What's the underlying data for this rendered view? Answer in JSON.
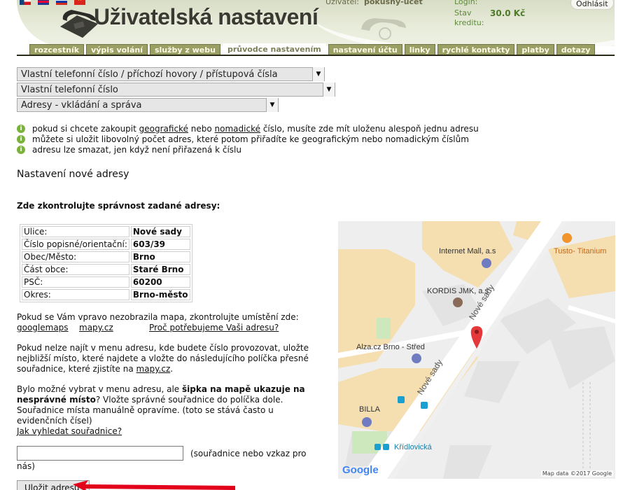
{
  "header": {
    "title": "Uživatelská nastavení",
    "user_label": "Uživatel:",
    "user_value": "pokusny-ucet",
    "login_label": "Login:",
    "credit_label": "Stav kreditu:",
    "credit_value": "30.0 Kč",
    "logout_label": "Odhlásit",
    "languages": [
      "cz-flag-icon",
      "gb-flag-icon",
      "ru-flag-icon",
      "vn-flag-icon"
    ]
  },
  "tabs": [
    {
      "label": "rozcestník",
      "active": false
    },
    {
      "label": "výpis volání",
      "active": false
    },
    {
      "label": "služby z webu",
      "active": false
    },
    {
      "label": "průvodce nastavením",
      "active": true
    },
    {
      "label": "nastavení účtu",
      "active": false
    },
    {
      "label": "linky",
      "active": false
    },
    {
      "label": "rychlé kontakty",
      "active": false
    },
    {
      "label": "platby",
      "active": false
    },
    {
      "label": "dotazy",
      "active": false
    }
  ],
  "selects": [
    {
      "value": "Vlastní telefonní číslo / příchozí hovory / přístupová čísla"
    },
    {
      "value": "Vlastní telefonní číslo"
    },
    {
      "value": "Adresy - vkládání a správa"
    }
  ],
  "info": {
    "line1_a": "pokud si chcete zakoupit ",
    "line1_link1": "geografické",
    "line1_b": " nebo ",
    "line1_link2": "nomadické",
    "line1_c": " číslo, musíte zde mít uloženu alespoň jednu adresu",
    "line2": "můžete si uložit libovolný počet adres, které potom přiřadíte ke geografickým nebo nomadickým číslům",
    "line3": "adresu lze smazat, jen když není přiřazená k číslu"
  },
  "section_title": "Nastavení nové adresy",
  "check_title": "Zde zkontrolujte správnost zadané adresy:",
  "address": [
    {
      "label": "Ulice:",
      "value": "Nové sady"
    },
    {
      "label": "Číslo popisné/orientační:",
      "value": "603/39"
    },
    {
      "label": "Obec/Město:",
      "value": "Brno"
    },
    {
      "label": "Část obce:",
      "value": "Staré Brno"
    },
    {
      "label": "PSČ:",
      "value": "60200"
    },
    {
      "label": "Okres:",
      "value": "Brno-město"
    }
  ],
  "para1": {
    "text": "Pokud se Vám vpravo nezobrazila mapa, zkontrolujte umístění zde:",
    "link_googlemaps": "googlemaps",
    "link_mapy": "mapy.cz",
    "link_why": "Proč potřebujeme Vaši adresu?"
  },
  "para2": {
    "text": "Pokud nelze najít v menu adresu, kde budete číslo provozovat, uložte nejbližší místo, které najdete a vložte do následujícího políčka přesné souřadnice, které zjistíte na ",
    "link": "mapy.cz",
    "end": "."
  },
  "para3": {
    "a": "Bylo možné vybrat v menu adresu, ale ",
    "bold": "šipka na mapě ukazuje na nesprávné místo",
    "b": "? Vložte správné souřadnice do políčka dole. Souřadnice místa manuálně opravíme. (toto se stává často u evidenčních čísel)",
    "link": "Jak vyhledat souřadnice?"
  },
  "coord": {
    "value": "",
    "note_line1": "(souřadnice nebo vzkaz pro",
    "note_line2": "nás)"
  },
  "save_label": "Uložit adresu",
  "map": {
    "pois": {
      "internet_mall": "Internet Mall, a.s",
      "tusto": "Tusto- Titanium",
      "kordis": "KORDIS JMK, a.s",
      "alza": "Alza.cz Brno - Střed",
      "billa": "BILLA",
      "kridlovicka": "Křídlovická"
    },
    "road_label": "Nové sady",
    "logo": "Google",
    "credit": "Map data ©2017 Google",
    "colors": {
      "building": "#f5deb0",
      "park": "#cde8bd",
      "road": "#ffffff",
      "marker": "#e5383b",
      "poi_shopping": "#6f7cc2",
      "poi_food": "#f0942b"
    }
  }
}
